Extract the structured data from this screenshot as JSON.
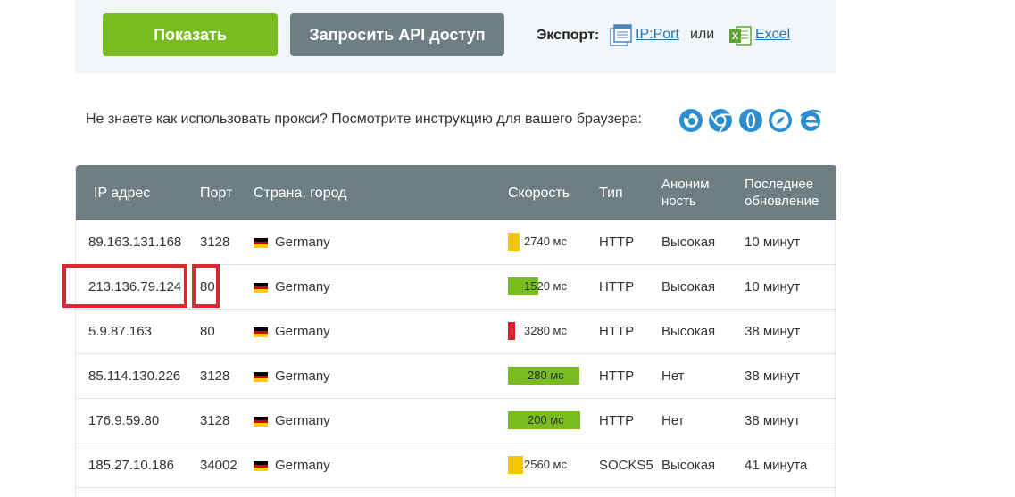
{
  "toolbar": {
    "show_button": "Показать",
    "api_button": "Запросить API доступ",
    "export_label": "Экспорт:",
    "export_ipport": "IP:Port",
    "export_or": "или",
    "export_excel": "Excel"
  },
  "help": {
    "text": "Не знаете как использовать прокси? Посмотрите инструкцию для вашего браузера:",
    "browsers": [
      "firefox-icon",
      "chrome-icon",
      "opera-icon",
      "safari-icon",
      "ie-icon"
    ]
  },
  "table": {
    "headers": {
      "ip": "IP адрес",
      "port": "Порт",
      "country": "Страна, город",
      "speed": "Скорость",
      "type": "Тип",
      "anon_1": "Аноним",
      "anon_2": "ность",
      "updated_1": "Последнее",
      "updated_2": "обновление"
    },
    "rows": [
      {
        "ip": "89.163.131.168",
        "port": "3128",
        "country": "Germany",
        "speed": "2740 мс",
        "speed_level": 0.16,
        "speed_color": "#f5c700",
        "type": "HTTP",
        "anon": "Высокая",
        "updated": "10 минут"
      },
      {
        "ip": "213.136.79.124",
        "port": "80",
        "country": "Germany",
        "speed": "1520 мс",
        "speed_level": 0.41,
        "speed_color": "#78bd1f",
        "type": "HTTP",
        "anon": "Высокая",
        "updated": "10 минут"
      },
      {
        "ip": "5.9.87.163",
        "port": "80",
        "country": "Germany",
        "speed": "3280 мс",
        "speed_level": 0.06,
        "speed_color": "#d9212a",
        "type": "HTTP",
        "anon": "Высокая",
        "updated": "38 минут"
      },
      {
        "ip": "85.114.130.226",
        "port": "3128",
        "country": "Germany",
        "speed": "280 мс",
        "speed_level": 0.95,
        "speed_color": "#78bd1f",
        "type": "HTTP",
        "anon": "Нет",
        "updated": "38 минут"
      },
      {
        "ip": "176.9.59.80",
        "port": "3128",
        "country": "Germany",
        "speed": "200 мс",
        "speed_level": 0.97,
        "speed_color": "#78bd1f",
        "type": "HTTP",
        "anon": "Нет",
        "updated": "38 минут"
      },
      {
        "ip": "185.27.10.186",
        "port": "34002",
        "country": "Germany",
        "speed": "2560 мс",
        "speed_level": 0.2,
        "speed_color": "#f5c700",
        "type": "SOCKS5",
        "anon": "Высокая",
        "updated": "41 минута"
      }
    ]
  },
  "colors": {
    "accent_green": "#78bd1f",
    "header_gray": "#6e7e83",
    "link_blue": "#2b73b0",
    "highlight_red": "#d22c33"
  }
}
